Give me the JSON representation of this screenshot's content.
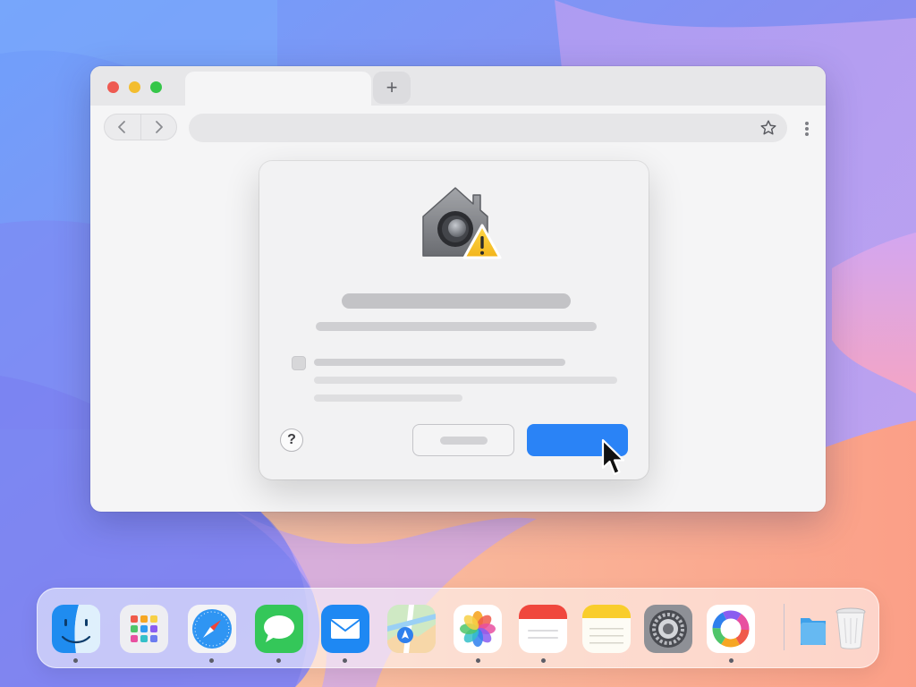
{
  "browser": {
    "tabs": [
      {
        "title": ""
      }
    ],
    "new_tab_icon": "plus-icon",
    "url": "",
    "bookmark_icon": "star-icon",
    "menu_icon": "more-vertical-icon"
  },
  "dialog": {
    "icon": "home-security-warning-icon",
    "title": "",
    "message": "",
    "checkbox_label": "",
    "help_label": "?",
    "cancel_label": "",
    "confirm_label": ""
  },
  "dock": {
    "apps": [
      {
        "name": "finder-icon",
        "running": true
      },
      {
        "name": "launchpad-icon",
        "running": false
      },
      {
        "name": "safari-icon",
        "running": true
      },
      {
        "name": "messages-icon",
        "running": true
      },
      {
        "name": "mail-icon",
        "running": true
      },
      {
        "name": "maps-icon",
        "running": false
      },
      {
        "name": "photos-icon",
        "running": true
      },
      {
        "name": "calendar-icon",
        "running": true
      },
      {
        "name": "notes-icon",
        "running": false
      },
      {
        "name": "system-settings-icon",
        "running": false
      },
      {
        "name": "color-picker-icon",
        "running": true
      },
      {
        "name": "downloads-folder-icon",
        "running": false
      },
      {
        "name": "trash-icon",
        "running": false
      }
    ]
  },
  "colors": {
    "accent": "#2a83f6",
    "window_bg": "#f5f5f6",
    "dialog_bg": "#f2f2f3"
  }
}
